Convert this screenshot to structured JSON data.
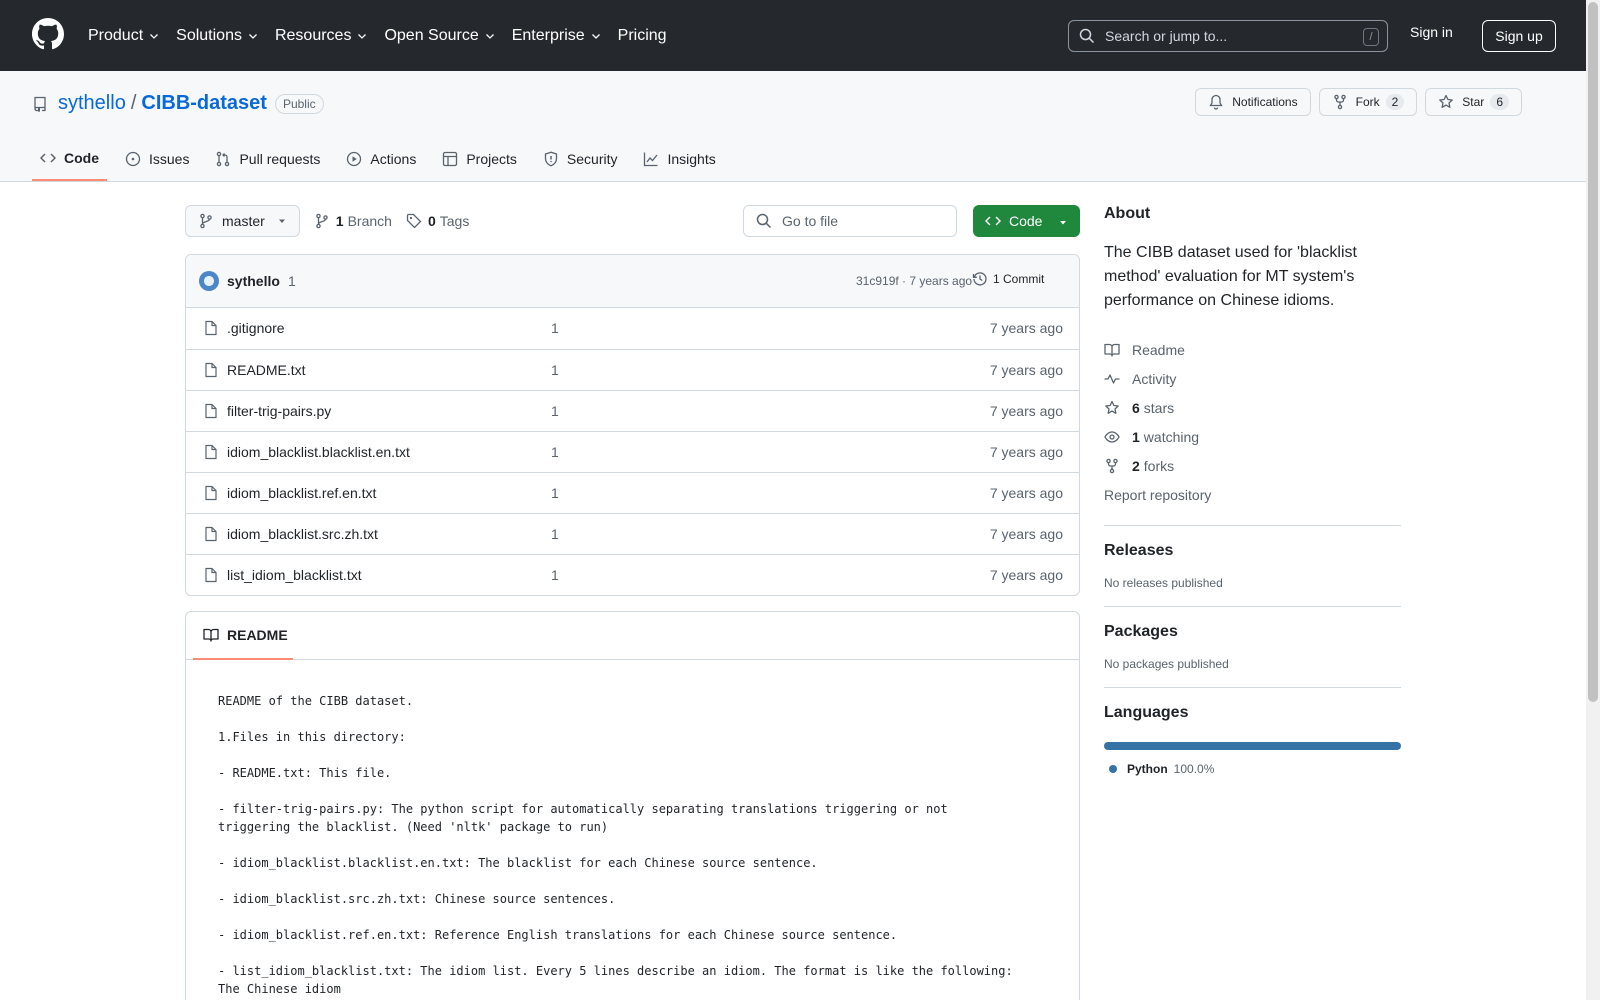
{
  "header": {
    "nav": [
      {
        "label": "Product",
        "dropdown": true
      },
      {
        "label": "Solutions",
        "dropdown": true
      },
      {
        "label": "Resources",
        "dropdown": true
      },
      {
        "label": "Open Source",
        "dropdown": true
      },
      {
        "label": "Enterprise",
        "dropdown": true
      },
      {
        "label": "Pricing",
        "dropdown": false
      }
    ],
    "search_placeholder": "Search or jump to...",
    "search_shortcut": "/",
    "sign_in": "Sign in",
    "sign_up": "Sign up"
  },
  "repo": {
    "owner": "sythello",
    "separator": "/",
    "name": "CIBB-dataset",
    "visibility": "Public",
    "notifications_label": "Notifications",
    "fork_label": "Fork",
    "fork_count": "2",
    "star_label": "Star",
    "star_count": "6",
    "tabs": [
      {
        "label": "Code",
        "icon": "code-icon",
        "active": true
      },
      {
        "label": "Issues",
        "icon": "issue-icon",
        "active": false
      },
      {
        "label": "Pull requests",
        "icon": "pull-request-icon",
        "active": false
      },
      {
        "label": "Actions",
        "icon": "play-icon",
        "active": false
      },
      {
        "label": "Projects",
        "icon": "table-icon",
        "active": false
      },
      {
        "label": "Security",
        "icon": "shield-icon",
        "active": false
      },
      {
        "label": "Insights",
        "icon": "graph-icon",
        "active": false
      }
    ]
  },
  "toolbar": {
    "branch": "master",
    "branch_count": "1",
    "branch_label": "Branch",
    "tag_count": "0",
    "tag_label": "Tags",
    "goto_placeholder": "Go to file",
    "code_button": "Code"
  },
  "commit": {
    "author": "sythello",
    "message": "1",
    "meta": "31c919f · 7 years ago",
    "count_label": "1 Commit"
  },
  "files": [
    {
      "name": ".gitignore",
      "message": "1",
      "date": "7 years ago"
    },
    {
      "name": "README.txt",
      "message": "1",
      "date": "7 years ago"
    },
    {
      "name": "filter-trig-pairs.py",
      "message": "1",
      "date": "7 years ago"
    },
    {
      "name": "idiom_blacklist.blacklist.en.txt",
      "message": "1",
      "date": "7 years ago"
    },
    {
      "name": "idiom_blacklist.ref.en.txt",
      "message": "1",
      "date": "7 years ago"
    },
    {
      "name": "idiom_blacklist.src.zh.txt",
      "message": "1",
      "date": "7 years ago"
    },
    {
      "name": "list_idiom_blacklist.txt",
      "message": "1",
      "date": "7 years ago"
    }
  ],
  "readme": {
    "tab_label": "README",
    "body": "README of the CIBB dataset.\n\n1.Files in this directory:\n\n- README.txt: This file.\n\n- filter-trig-pairs.py: The python script for automatically separating translations triggering or not triggering the blacklist. (Need 'nltk' package to run)\n\n- idiom_blacklist.blacklist.en.txt: The blacklist for each Chinese source sentence.\n\n- idiom_blacklist.src.zh.txt: Chinese source sentences.\n\n- idiom_blacklist.ref.en.txt: Reference English translations for each Chinese source sentence.\n\n- list_idiom_blacklist.txt: The idiom list. Every 5 lines describe an idiom. The format is like the following:\nThe Chinese idiom"
  },
  "sidebar": {
    "about_title": "About",
    "description": "The CIBB dataset used for 'blacklist method' evaluation for MT system's performance on Chinese idioms.",
    "readme": "Readme",
    "activity": "Activity",
    "stars_count": "6",
    "stars_label": "stars",
    "watching_count": "1",
    "watching_label": "watching",
    "forks_count": "2",
    "forks_label": "forks",
    "report": "Report repository",
    "releases_title": "Releases",
    "releases_text": "No releases published",
    "packages_title": "Packages",
    "packages_text": "No packages published",
    "languages_title": "Languages",
    "language_name": "Python",
    "language_pct": "100.0%",
    "language_color": "#3572a5"
  }
}
